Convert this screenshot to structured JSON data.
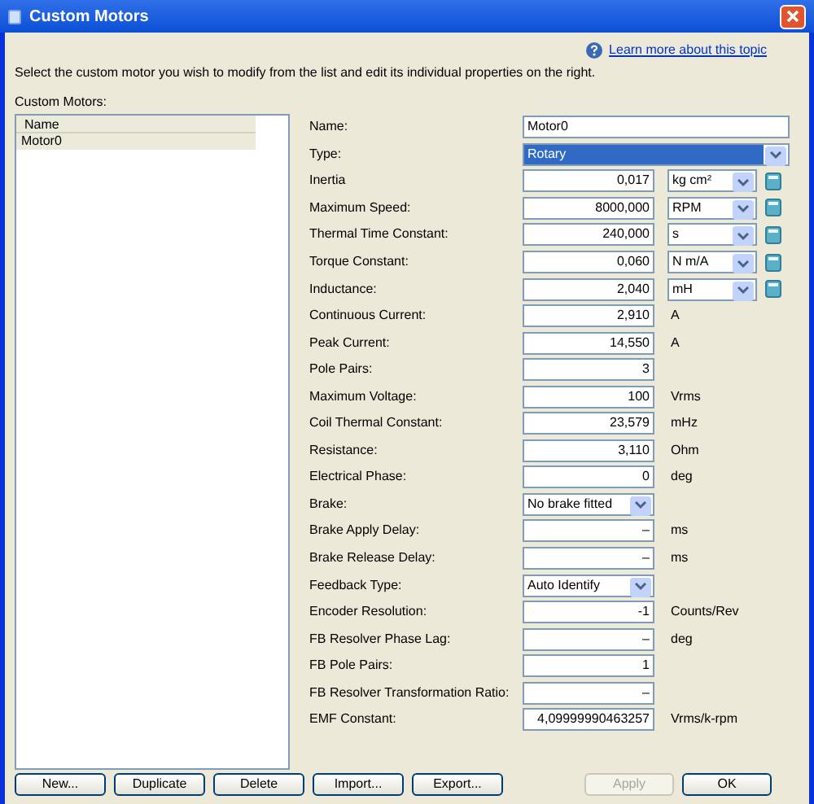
{
  "window": {
    "title": "Custom Motors"
  },
  "help_link": "Learn more about this topic",
  "instructions": "Select the custom motor you wish to modify from the list and edit its individual properties on the right.",
  "motor_list": {
    "label": "Custom Motors:",
    "column": "Name",
    "items": [
      {
        "name": "Motor0",
        "selected": true
      }
    ]
  },
  "properties": [
    {
      "kind": "text",
      "label": "Name:",
      "value": "Motor0"
    },
    {
      "kind": "wide_dropdown",
      "label": "Type:",
      "value": "Rotary",
      "selected": true
    },
    {
      "kind": "unit_dropdown",
      "label": "Inertia",
      "value": "0,017",
      "unit": "kg cm²"
    },
    {
      "kind": "unit_dropdown",
      "label": "Maximum Speed:",
      "value": "8000,000",
      "unit": "RPM"
    },
    {
      "kind": "unit_dropdown",
      "label": "Thermal Time Constant:",
      "value": "240,000",
      "unit": "s"
    },
    {
      "kind": "unit_dropdown",
      "label": "Torque Constant:",
      "value": "0,060",
      "unit": "N m/A"
    },
    {
      "kind": "unit_dropdown",
      "label": "Inductance:",
      "value": "2,040",
      "unit": "mH"
    },
    {
      "kind": "number",
      "label": "Continuous Current:",
      "value": "2,910",
      "unit": "A"
    },
    {
      "kind": "number",
      "label": "Peak Current:",
      "value": "14,550",
      "unit": "A"
    },
    {
      "kind": "number",
      "label": "Pole Pairs:",
      "value": "3"
    },
    {
      "kind": "number",
      "label": "Maximum Voltage:",
      "value": "100",
      "unit": "Vrms"
    },
    {
      "kind": "number",
      "label": "Coil Thermal Constant:",
      "value": "23,579",
      "unit": "mHz"
    },
    {
      "kind": "number",
      "label": "Resistance:",
      "value": "3,110",
      "unit": "Ohm"
    },
    {
      "kind": "number",
      "label": "Electrical Phase:",
      "value": "0",
      "unit": "deg"
    },
    {
      "kind": "dropdown",
      "label": "Brake:",
      "value": "No brake fitted"
    },
    {
      "kind": "number",
      "label": "Brake Apply Delay:",
      "value": "–",
      "unit": "ms"
    },
    {
      "kind": "number",
      "label": "Brake Release Delay:",
      "value": "–",
      "unit": "ms"
    },
    {
      "kind": "dropdown",
      "label": "Feedback Type:",
      "value": "Auto Identify"
    },
    {
      "kind": "number",
      "label": "Encoder Resolution:",
      "value": "-1",
      "unit": "Counts/Rev"
    },
    {
      "kind": "number",
      "label": "FB Resolver Phase Lag:",
      "value": "–",
      "unit": "deg"
    },
    {
      "kind": "number",
      "label": "FB Pole Pairs:",
      "value": "1"
    },
    {
      "kind": "number",
      "label": "FB Resolver Transformation Ratio:",
      "value": "–"
    },
    {
      "kind": "number",
      "label": "EMF Constant:",
      "value": "4,09999990463257",
      "unit": "Vrms/k-rpm"
    }
  ],
  "left_buttons": [
    {
      "label": "New...",
      "disabled": false
    },
    {
      "label": "Duplicate",
      "disabled": false
    },
    {
      "label": "Delete",
      "disabled": false
    },
    {
      "label": "Import...",
      "disabled": false
    },
    {
      "label": "Export...",
      "disabled": false
    }
  ],
  "right_buttons": [
    {
      "label": "Apply",
      "disabled": true
    },
    {
      "label": "OK",
      "disabled": false
    }
  ]
}
